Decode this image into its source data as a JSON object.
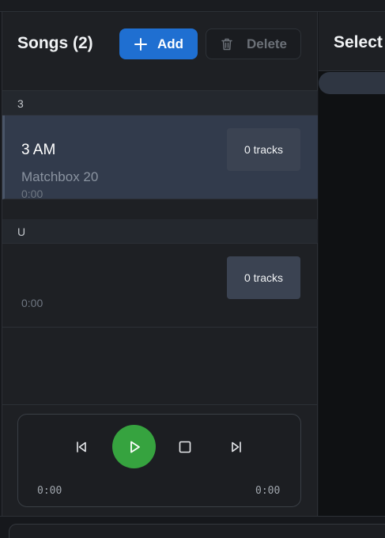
{
  "songs_panel": {
    "title": "Songs (2)",
    "add_label": "Add",
    "delete_label": "Delete"
  },
  "groups": [
    {
      "letter": "3",
      "songs": [
        {
          "title": "3 AM",
          "artist": "Matchbox 20",
          "duration": "0:00",
          "tracks": "0 tracks",
          "selected": true
        }
      ]
    },
    {
      "letter": "U",
      "songs": [
        {
          "title": "",
          "artist": "",
          "duration": "0:00",
          "tracks": "0 tracks",
          "selected": false
        }
      ]
    }
  ],
  "player": {
    "elapsed": "0:00",
    "total": "0:00"
  },
  "right_panel": {
    "title": "Select"
  },
  "colors": {
    "accent_blue": "#1f6fd1",
    "play_green": "#36a33f",
    "selected_row": "#323b4c"
  }
}
